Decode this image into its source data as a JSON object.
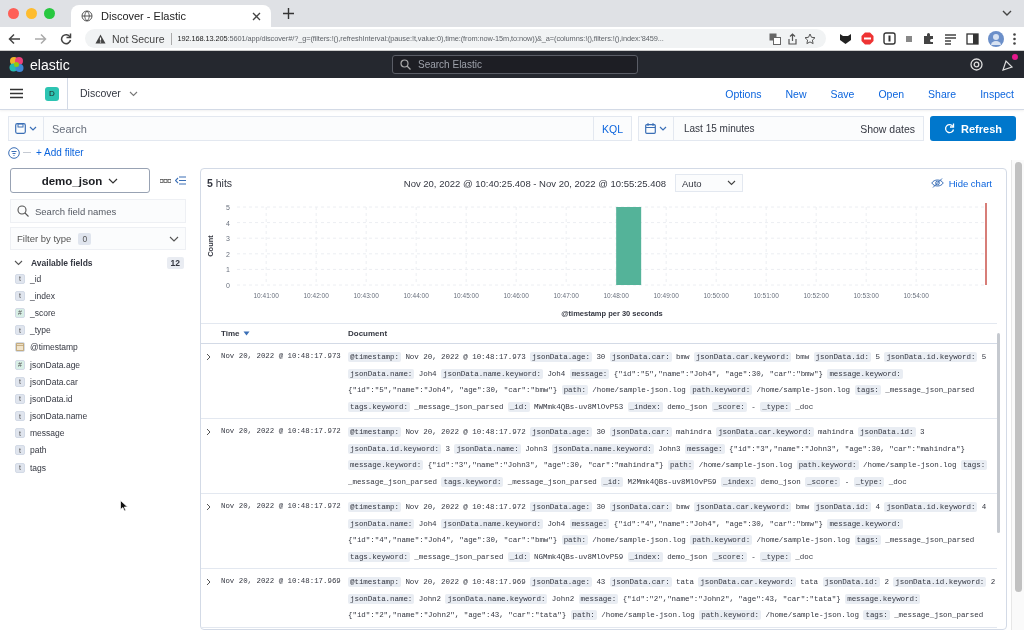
{
  "browser": {
    "tab_title": "Discover - Elastic",
    "not_secure": "Not Secure",
    "url_host": "192.168.13.205",
    "url_rest": ":5601/app/discover#/?_g=(filters:!(),refreshInterval:(pause:!t,value:0),time:(from:now-15m,to:now))&_a=(columns:!(),filters:!(),index:'8459..."
  },
  "header": {
    "logo": "elastic",
    "search_placeholder": "Search Elastic",
    "news_unread": true
  },
  "app_bar": {
    "space_initial": "D",
    "app": "Discover",
    "actions": [
      "Options",
      "New",
      "Save",
      "Open",
      "Share",
      "Inspect"
    ]
  },
  "query_bar": {
    "placeholder": "Search",
    "language": "KQL",
    "time_range": "Last 15 minutes",
    "show_dates": "Show dates",
    "refresh": "Refresh"
  },
  "filter_bar": {
    "add_filter": "+ Add filter"
  },
  "sidebar": {
    "index_pattern": "demo_json",
    "search_placeholder": "Search field names",
    "filter_label": "Filter by type",
    "filter_count": "0",
    "section": "Available fields",
    "section_count": "12",
    "expanded": true,
    "fields": [
      {
        "name": "_id",
        "kind": "string",
        "glyph": "t"
      },
      {
        "name": "_index",
        "kind": "string",
        "glyph": "t"
      },
      {
        "name": "_score",
        "kind": "number",
        "glyph": "#"
      },
      {
        "name": "_type",
        "kind": "string",
        "glyph": "t"
      },
      {
        "name": "@timestamp",
        "kind": "date"
      },
      {
        "name": "jsonData.age",
        "kind": "number",
        "glyph": "#"
      },
      {
        "name": "jsonData.car",
        "kind": "string",
        "glyph": "t"
      },
      {
        "name": "jsonData.id",
        "kind": "string",
        "glyph": "t"
      },
      {
        "name": "jsonData.name",
        "kind": "string",
        "glyph": "t"
      },
      {
        "name": "message",
        "kind": "string",
        "glyph": "t"
      },
      {
        "name": "path",
        "kind": "string",
        "glyph": "t"
      },
      {
        "name": "tags",
        "kind": "string",
        "glyph": "t"
      }
    ]
  },
  "results": {
    "hits": "**5** hits",
    "range": "Nov 20, 2022 @ 10:40:25.408 - Nov 20, 2022 @ 10:55:25.408",
    "interval": "Auto",
    "hide_chart": "Hide chart",
    "chart_data": {
      "type": "bar",
      "xlabel": "@timestamp per 30 seconds",
      "ylabel": "Count",
      "categories": [
        "10:41:00",
        "10:42:00",
        "10:43:00",
        "10:44:00",
        "10:45:00",
        "10:46:00",
        "10:47:00",
        "10:48:00",
        "10:49:00",
        "10:50:00",
        "10:51:00",
        "10:52:00",
        "10:53:00",
        "10:54:00"
      ],
      "values": [
        0,
        0,
        0,
        0,
        0,
        0,
        0,
        5,
        0,
        0,
        0,
        0,
        0,
        0
      ],
      "ylim": [
        0,
        5
      ],
      "yticks": [
        0,
        1,
        2,
        3,
        4,
        5
      ],
      "grid": true
    },
    "columns": [
      {
        "label": "Time",
        "sorted": true
      },
      {
        "label": "Document",
        "sorted": false
      }
    ],
    "rows": [
      {
        "time": "Nov 20, 2022 @ 10:48:17.973",
        "expanded": false,
        "fields": [
          {
            "key": "@timestamp:",
            "value": "Nov 20, 2022 @ 10:48:17.973"
          },
          {
            "key": "jsonData.age:",
            "value": "30"
          },
          {
            "key": "jsonData.car:",
            "value": "bmw"
          },
          {
            "key": "jsonData.car.keyword:",
            "value": "bmw"
          },
          {
            "key": "jsonData.id:",
            "value": "5"
          },
          {
            "key": "jsonData.id.keyword:",
            "value": "5"
          },
          {
            "key": "jsonData.name:",
            "value": "Joh4"
          },
          {
            "key": "jsonData.name.keyword:",
            "value": "Joh4"
          },
          {
            "key": "message:",
            "value": "{\"id\":\"5\",\"name\":\"Joh4\", \"age\":30, \"car\":\"bmw\"}"
          },
          {
            "key": "message.keyword:",
            "value": "{\"id\":\"5\",\"name\":\"Joh4\", \"age\":30, \"car\":\"bmw\"}"
          },
          {
            "key": "path:",
            "value": "/home/sample-json.log"
          },
          {
            "key": "path.keyword:",
            "value": "/home/sample-json.log"
          },
          {
            "key": "tags:",
            "value": "_message_json_parsed"
          },
          {
            "key": "tags.keyword:",
            "value": "_message_json_parsed"
          },
          {
            "key": "_id:",
            "value": "MWMmk4QBs-uv8MlOvP53"
          },
          {
            "key": "_index:",
            "value": "demo_json"
          },
          {
            "key": "_score:",
            "value": "-"
          },
          {
            "key": "_type:",
            "value": "_doc"
          }
        ]
      },
      {
        "time": "Nov 20, 2022 @ 10:48:17.972",
        "expanded": false,
        "fields": [
          {
            "key": "@timestamp:",
            "value": "Nov 20, 2022 @ 10:48:17.972"
          },
          {
            "key": "jsonData.age:",
            "value": "30"
          },
          {
            "key": "jsonData.car:",
            "value": "mahindra"
          },
          {
            "key": "jsonData.car.keyword:",
            "value": "mahindra"
          },
          {
            "key": "jsonData.id:",
            "value": "3"
          },
          {
            "key": "jsonData.id.keyword:",
            "value": "3"
          },
          {
            "key": "jsonData.name:",
            "value": "John3"
          },
          {
            "key": "jsonData.name.keyword:",
            "value": "John3"
          },
          {
            "key": "message:",
            "value": "{\"id\":\"3\",\"name\":\"John3\", \"age\":30, \"car\":\"mahindra\"}"
          },
          {
            "key": "message.keyword:",
            "value": "{\"id\":\"3\",\"name\":\"John3\", \"age\":30, \"car\":\"mahindra\"}"
          },
          {
            "key": "path:",
            "value": "/home/sample-json.log"
          },
          {
            "key": "path.keyword:",
            "value": "/home/sample-json.log"
          },
          {
            "key": "tags:",
            "value": "_message_json_parsed"
          },
          {
            "key": "tags.keyword:",
            "value": "_message_json_parsed"
          },
          {
            "key": "_id:",
            "value": "M2Mmk4QBs-uv8MlOvP59"
          },
          {
            "key": "_index:",
            "value": "demo_json"
          },
          {
            "key": "_score:",
            "value": "-"
          },
          {
            "key": "_type:",
            "value": "_doc"
          }
        ]
      },
      {
        "time": "Nov 20, 2022 @ 10:48:17.972",
        "expanded": false,
        "fields": [
          {
            "key": "@timestamp:",
            "value": "Nov 20, 2022 @ 10:48:17.972"
          },
          {
            "key": "jsonData.age:",
            "value": "30"
          },
          {
            "key": "jsonData.car:",
            "value": "bmw"
          },
          {
            "key": "jsonData.car.keyword:",
            "value": "bmw"
          },
          {
            "key": "jsonData.id:",
            "value": "4"
          },
          {
            "key": "jsonData.id.keyword:",
            "value": "4"
          },
          {
            "key": "jsonData.name:",
            "value": "Joh4"
          },
          {
            "key": "jsonData.name.keyword:",
            "value": "Joh4"
          },
          {
            "key": "message:",
            "value": "{\"id\":\"4\",\"name\":\"Joh4\", \"age\":30, \"car\":\"bmw\"}"
          },
          {
            "key": "message.keyword:",
            "value": "{\"id\":\"4\",\"name\":\"Joh4\", \"age\":30, \"car\":\"bmw\"}"
          },
          {
            "key": "path:",
            "value": "/home/sample-json.log"
          },
          {
            "key": "path.keyword:",
            "value": "/home/sample-json.log"
          },
          {
            "key": "tags:",
            "value": "_message_json_parsed"
          },
          {
            "key": "tags.keyword:",
            "value": "_message_json_parsed"
          },
          {
            "key": "_id:",
            "value": "NGMmk4QBs-uv8MlOvP59"
          },
          {
            "key": "_index:",
            "value": "demo_json"
          },
          {
            "key": "_score:",
            "value": "-"
          },
          {
            "key": "_type:",
            "value": "_doc"
          }
        ]
      },
      {
        "time": "Nov 20, 2022 @ 10:48:17.969",
        "expanded": false,
        "fields": [
          {
            "key": "@timestamp:",
            "value": "Nov 20, 2022 @ 10:48:17.969"
          },
          {
            "key": "jsonData.age:",
            "value": "43"
          },
          {
            "key": "jsonData.car:",
            "value": "tata"
          },
          {
            "key": "jsonData.car.keyword:",
            "value": "tata"
          },
          {
            "key": "jsonData.id:",
            "value": "2"
          },
          {
            "key": "jsonData.id.keyword:",
            "value": "2"
          },
          {
            "key": "jsonData.name:",
            "value": "John2"
          },
          {
            "key": "jsonData.name.keyword:",
            "value": "John2"
          },
          {
            "key": "message:",
            "value": "{\"id\":\"2\",\"name\":\"John2\", \"age\":43, \"car\":\"tata\"}"
          },
          {
            "key": "message.keyword:",
            "value": "{\"id\":\"2\",\"name\":\"John2\", \"age\":43, \"car\":\"tata\"}"
          },
          {
            "key": "path:",
            "value": "/home/sample-json.log"
          },
          {
            "key": "path.keyword:",
            "value": "/home/sample-json.log"
          },
          {
            "key": "tags:",
            "value": "_message_json_parsed"
          }
        ]
      }
    ]
  }
}
